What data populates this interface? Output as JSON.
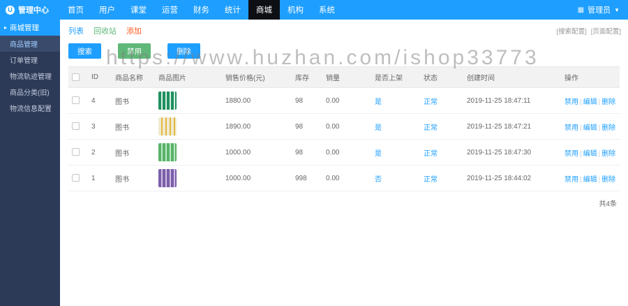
{
  "navbar": {
    "brand": "管理中心",
    "items": [
      {
        "key": "home",
        "label": "首页"
      },
      {
        "key": "user",
        "label": "用户"
      },
      {
        "key": "classroom",
        "label": "课堂"
      },
      {
        "key": "operation",
        "label": "运营"
      },
      {
        "key": "finance",
        "label": "财务"
      },
      {
        "key": "statistics",
        "label": "统计"
      },
      {
        "key": "mall",
        "label": "商城",
        "active": true
      },
      {
        "key": "organization",
        "label": "机构"
      },
      {
        "key": "system",
        "label": "系统"
      }
    ],
    "user_label": "管理员"
  },
  "sidebar": {
    "group_label": "商城管理",
    "items": [
      {
        "key": "goods",
        "label": "商品管理",
        "active": true
      },
      {
        "key": "orders",
        "label": "订单管理"
      },
      {
        "key": "logistics-track",
        "label": "物流轨迹管理"
      },
      {
        "key": "category-old",
        "label": "商品分类(旧)"
      },
      {
        "key": "logistics-config",
        "label": "物流信息配置"
      }
    ]
  },
  "toolbar": {
    "tabs": [
      {
        "key": "list",
        "label": "列表",
        "color": "#1E9FFF"
      },
      {
        "key": "recycle",
        "label": "回收站",
        "color": "#5FB878"
      },
      {
        "key": "add",
        "label": "添加",
        "color": "#FF5722"
      }
    ],
    "config_links": [
      {
        "key": "search-config",
        "label": "[搜索配置]"
      },
      {
        "key": "page-config",
        "label": "[页面配置]"
      }
    ],
    "buttons": [
      {
        "key": "search",
        "label": "搜索",
        "color": "#1E9FFF"
      },
      {
        "key": "disable",
        "label": "禁用",
        "color": "#5FB878"
      },
      {
        "key": "delete",
        "label": "删除",
        "color": "#1E9FFF"
      }
    ]
  },
  "table": {
    "headers": [
      "ID",
      "商品名称",
      "商品图片",
      "销售价格(元)",
      "库存",
      "销量",
      "是否上架",
      "状态",
      "创建时间",
      "操作"
    ],
    "rows": [
      {
        "id": "4",
        "name": "图书",
        "thumb": [
          "#1f8f5f",
          "#d9f2e6"
        ],
        "price": "1880.00",
        "stock": "98",
        "sales": "0.00",
        "on_shelf": "是",
        "status": "正常",
        "created": "2019-11-25 18:47:11",
        "ops": [
          "禁用",
          "编辑",
          "删除"
        ]
      },
      {
        "id": "3",
        "name": "图书",
        "thumb": [
          "#f0ead2",
          "#e3b93e"
        ],
        "price": "1890.00",
        "stock": "98",
        "sales": "0.00",
        "on_shelf": "是",
        "status": "正常",
        "created": "2019-11-25 18:47:21",
        "ops": [
          "禁用",
          "编辑",
          "删除"
        ]
      },
      {
        "id": "2",
        "name": "图书",
        "thumb": [
          "#58b368",
          "#bfe8c5"
        ],
        "price": "1000.00",
        "stock": "98",
        "sales": "0.00",
        "on_shelf": "是",
        "status": "正常",
        "created": "2019-11-25 18:47:30",
        "ops": [
          "禁用",
          "编辑",
          "删除"
        ]
      },
      {
        "id": "1",
        "name": "图书",
        "thumb": [
          "#7a5fa8",
          "#cdbde6"
        ],
        "price": "1000.00",
        "stock": "998",
        "sales": "0.00",
        "on_shelf": "否",
        "status": "正常",
        "created": "2019-11-25 18:44:02",
        "ops": [
          "禁用",
          "编辑",
          "删除"
        ]
      }
    ]
  },
  "pagination": {
    "total": "共4条"
  },
  "watermark": "https://www.huzhan.com/ishop33773",
  "colors": {
    "primary": "#1E9FFF",
    "green": "#5FB878",
    "red": "#FF5722",
    "nav_active": "#0d0f14",
    "sidebar_bg": "#2c3a57"
  }
}
